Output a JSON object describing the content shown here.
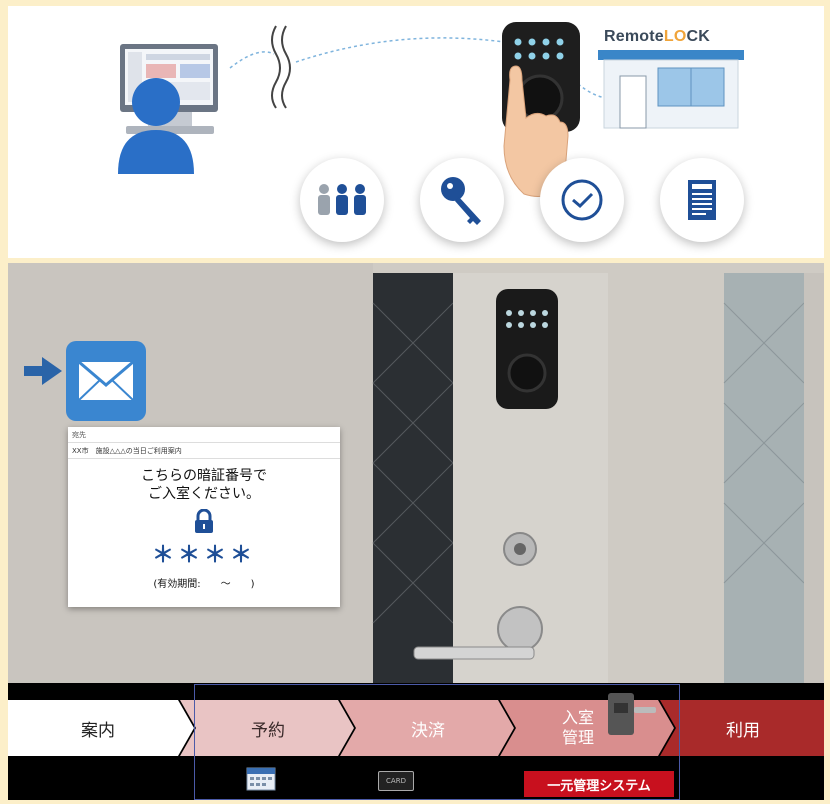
{
  "brand": {
    "prefix": "Remote",
    "lock": "L",
    "o": "O",
    "suffix": "CK"
  },
  "icons": {
    "group": "people-icon",
    "key": "key-icon",
    "clock": "clock-check-icon",
    "doc": "document-icon",
    "mail": "mail-icon",
    "arrow": "arrow-right-icon",
    "padlock": "padlock-icon",
    "calendar": "calendar-icon",
    "card": "card-icon"
  },
  "mail": {
    "header": "宛先",
    "subject": "XX市　施設△△△の当日ご利用案内",
    "line1": "こちらの暗証番号で",
    "line2": "ご入室ください。",
    "code": "＊＊＊＊",
    "period": "(有効期間:　　～　　)"
  },
  "steps": [
    {
      "label": "案内"
    },
    {
      "label": "予約"
    },
    {
      "label": "決済"
    },
    {
      "label1": "入室",
      "label2": "管理"
    },
    {
      "label": "利用"
    }
  ],
  "card_label": "CARD",
  "system_label": "一元管理システム",
  "colors": {
    "accent_blue": "#1f4f97",
    "step_red": "#c8101e"
  }
}
